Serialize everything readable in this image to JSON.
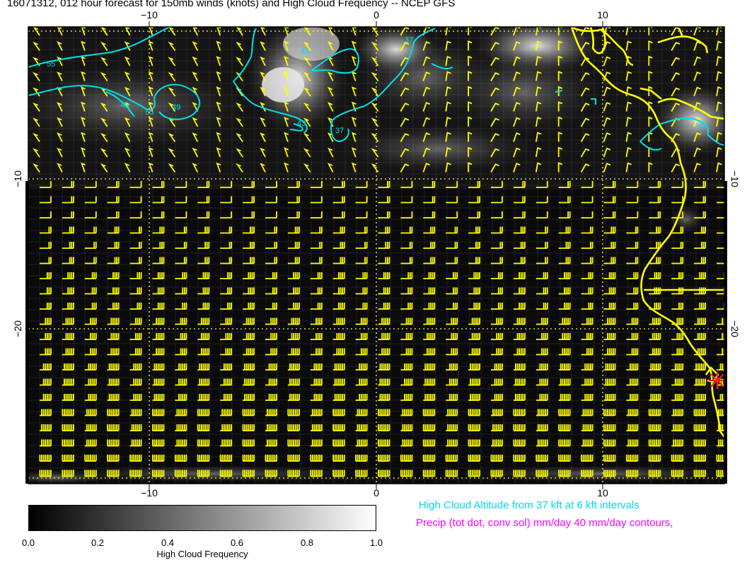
{
  "title": "16071312, 012 hour forecast for 150mb winds (knots) and High Cloud Frequency -- NCEP GFS",
  "map": {
    "lon_range": [
      -15.5,
      15.5
    ],
    "lat_range": [
      -30,
      0
    ],
    "x_tick_labels": [
      "−10",
      "0",
      "10"
    ],
    "y_tick_labels": [
      "−10",
      "−20"
    ],
    "contour_labels": [
      "55",
      "49",
      "55",
      "49",
      "43",
      "43",
      "37",
      "37",
      "43"
    ],
    "colors": {
      "background": "#0a0a0a",
      "wind_barbs": "#ffff00",
      "coastline": "#ffff00",
      "contours": "#00e0e8",
      "gridlines": "#ffff66",
      "marker": "#ff2020"
    },
    "marker_icon": "red-asterisk-icon"
  },
  "annotations": {
    "cloud_altitude": "High Cloud Altitude from 37 kft at 6 kft intervals",
    "precip": "Precip (tot dot, conv sol) mm/day 40 mm/day contours,"
  },
  "colorbar": {
    "title": "High Cloud Frequency",
    "ticks": [
      "0.0",
      "0.2",
      "0.4",
      "0.6",
      "0.8",
      "1.0"
    ]
  }
}
